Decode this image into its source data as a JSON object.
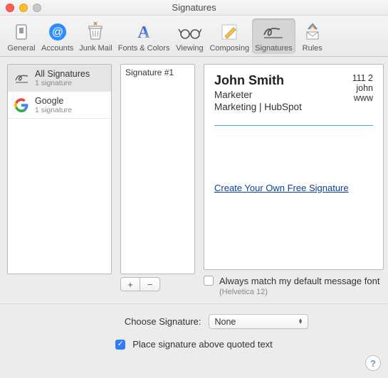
{
  "window": {
    "title": "Signatures"
  },
  "toolbar": {
    "items": [
      {
        "label": "General"
      },
      {
        "label": "Accounts"
      },
      {
        "label": "Junk Mail"
      },
      {
        "label": "Fonts & Colors"
      },
      {
        "label": "Viewing"
      },
      {
        "label": "Composing"
      },
      {
        "label": "Signatures"
      },
      {
        "label": "Rules"
      }
    ],
    "selected_index": 6
  },
  "accounts": [
    {
      "title": "All Signatures",
      "subtitle": "1 signature",
      "icon": "signature"
    },
    {
      "title": "Google",
      "subtitle": "1 signature",
      "icon": "google"
    }
  ],
  "signature_list": {
    "items": [
      "Signature #1"
    ]
  },
  "buttons": {
    "add": "+",
    "remove": "−"
  },
  "preview": {
    "name": "John Smith",
    "role": "Marketer",
    "company": "Marketing | HubSpot",
    "right1": "111 2",
    "right2": "john",
    "right3": "www",
    "link": "Create Your Own Free Signature"
  },
  "below": {
    "match_font_label": "Always match my default message font",
    "match_font_hint": "(Helvetica 12)"
  },
  "footer": {
    "choose_label": "Choose Signature:",
    "choose_value": "None",
    "place_label": "Place signature above quoted text"
  }
}
